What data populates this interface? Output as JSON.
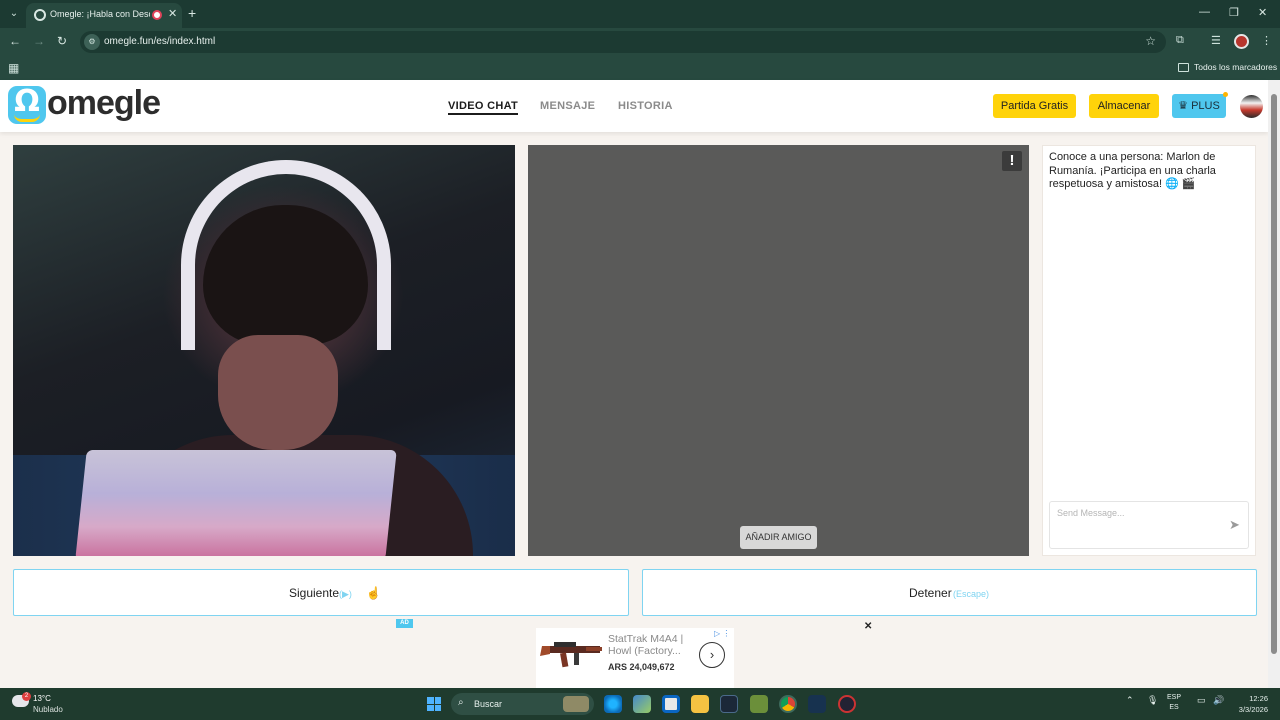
{
  "browser": {
    "tab_title": "Omegle: ¡Habla con Descon",
    "url": "omegle.fun/es/index.html",
    "bookmarks_label": "Todos los marcadores"
  },
  "site": {
    "logo_text": "omegle",
    "nav": [
      "VIDEO CHAT",
      "MENSAJE",
      "HISTORIA"
    ],
    "active_nav": "VIDEO CHAT",
    "buttons": {
      "free_game": "Partida Gratis",
      "store": "Almacenar",
      "plus": "PLUS"
    }
  },
  "video": {
    "report_icon": "!",
    "add_friend_label": "AÑADIR AMIGO"
  },
  "chat": {
    "message": "Conoce a una persona: Marlon de Rumanía. ¡Participa en una charla respetuosa y amistosa! 🌐 🎬",
    "input_placeholder": "Send Message..."
  },
  "actions": {
    "next_label": "Siguiente",
    "next_hint": "(▶)",
    "stop_label": "Detener",
    "stop_hint": "(Escape)"
  },
  "ad": {
    "badge": "AD",
    "title": "StatTrak M4A4 | Howl (Factory...",
    "price": "ARS 24,049,672"
  },
  "taskbar": {
    "temp": "13°C",
    "weather": "Nublado",
    "weather_badge": "2",
    "search_label": "Buscar",
    "lang_1": "ESP",
    "lang_2": "ES",
    "time": "12:26",
    "date": "3/3/2026"
  },
  "colors": {
    "accent_blue": "#4fc7ee",
    "accent_yellow": "#ffd30a",
    "chrome_green": "#27493f"
  }
}
